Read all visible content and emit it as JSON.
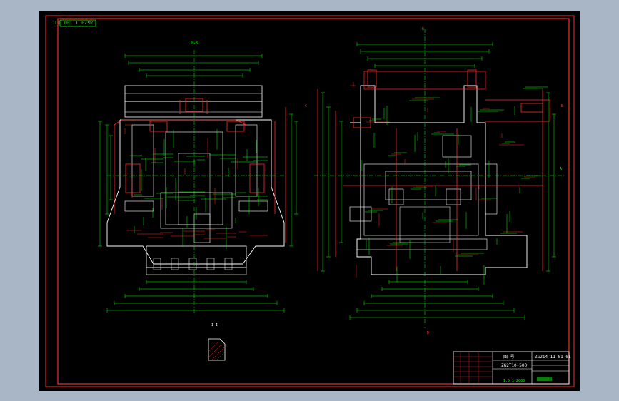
{
  "colors": {
    "window_bg": "#a9b6c6",
    "model_space": "#000000",
    "frame": "#ff2a2a",
    "geometry": "#ffffff",
    "dimensions": "#00ff00",
    "section_marks": "#ff2a2a"
  },
  "stamp": {
    "text": "ZG70 11 01 01"
  },
  "views": {
    "left_top_label": "8-8",
    "section_small": "I-I",
    "right_marks": {
      "b_top": "B",
      "b_bottom": "B",
      "c": "C",
      "e": "E",
      "a": "A",
      "d": "D"
    }
  },
  "title_block": {
    "drawing_no": "ZG214-11-01-01",
    "part_name": "ZG2T10-500",
    "scale_label": "图 号",
    "sub_label": "1:5 1-2000"
  }
}
